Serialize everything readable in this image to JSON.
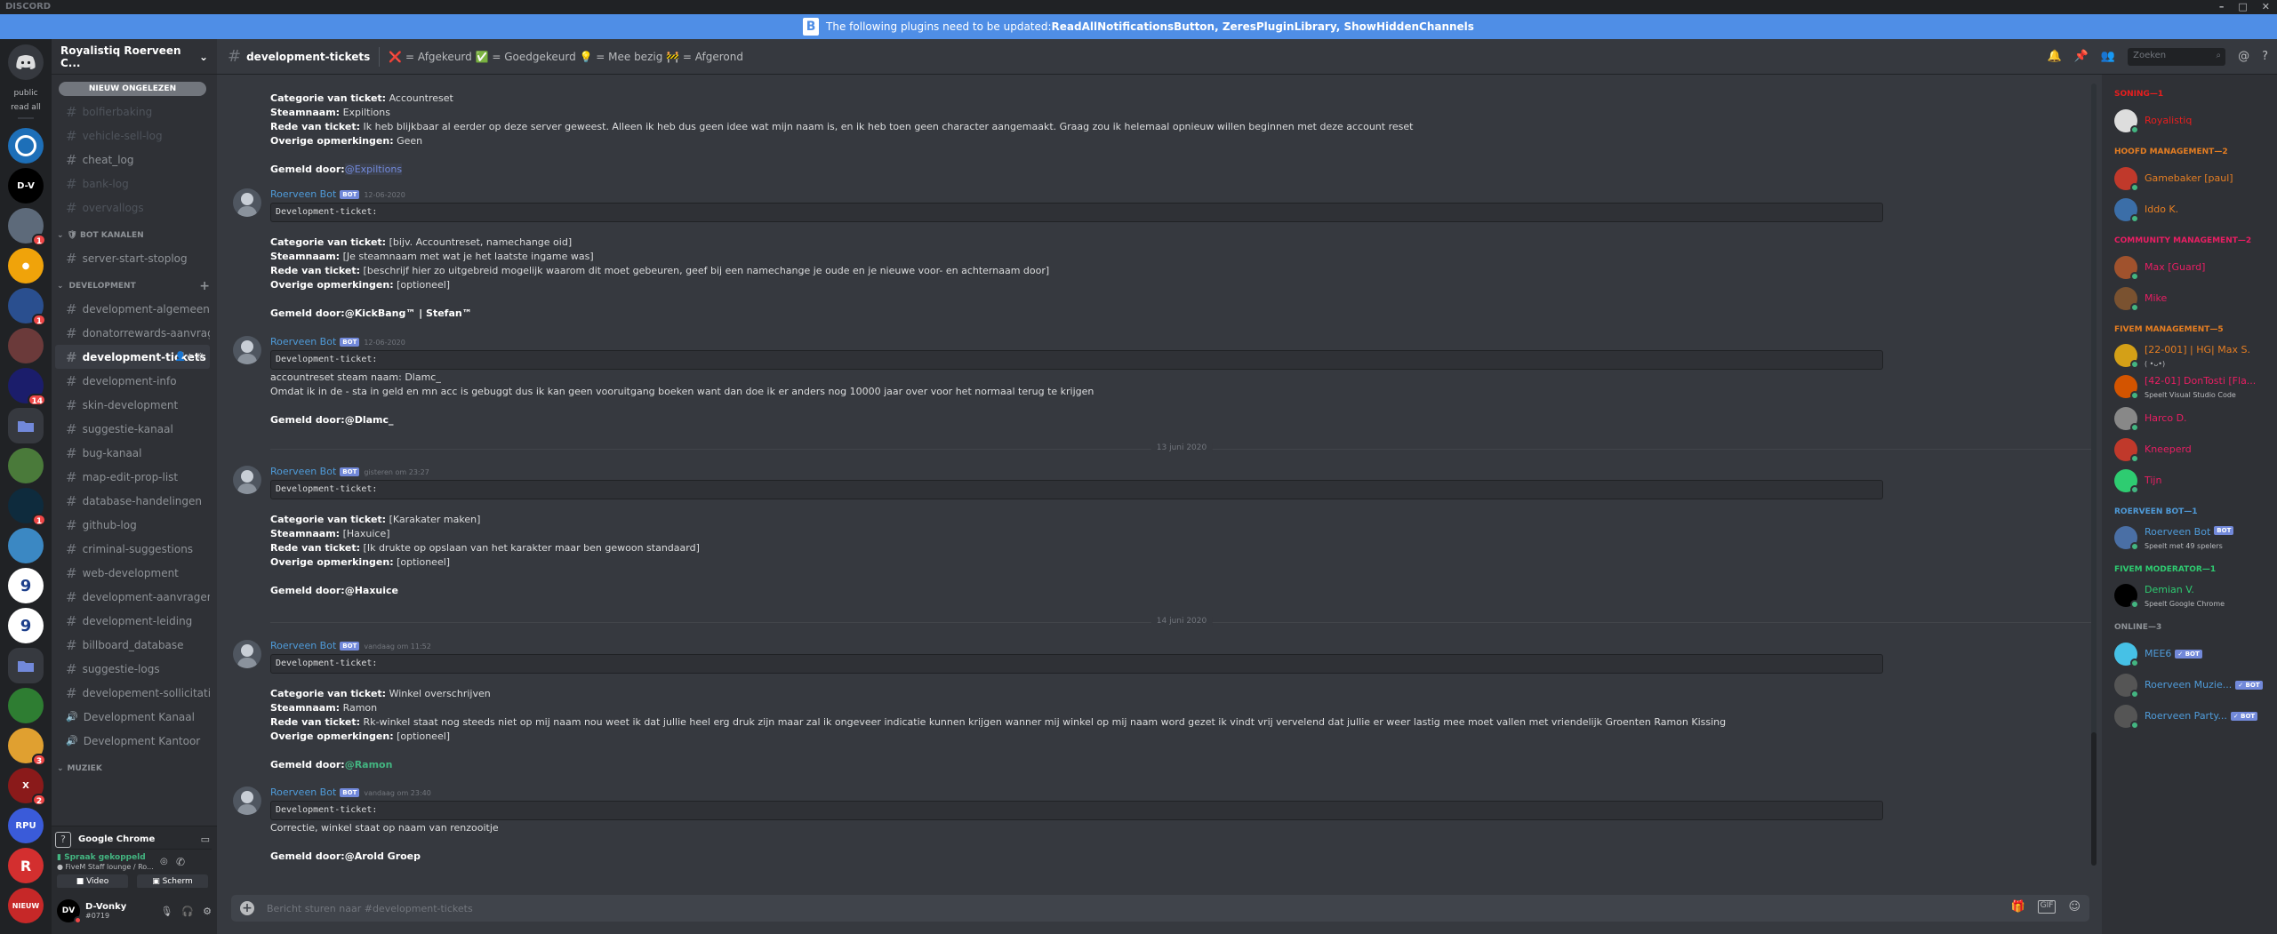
{
  "window": {
    "title": "DISCORD"
  },
  "banner": {
    "text_prefix": "The following plugins need to be updated: ",
    "plugins": "ReadAllNotificationsButton, ZeresPluginLibrary, ShowHiddenChannels"
  },
  "rail": {
    "labels": {
      "public": "public",
      "read_all": "read all",
      "new": "NIEUW",
      "rpu": "RPU"
    },
    "badges": [
      "1",
      "1",
      "14",
      "1",
      "3",
      "2"
    ]
  },
  "guild": {
    "name": "Royalistiq Roerveen C...",
    "unread_button": "NIEUW ONGELEZEN"
  },
  "channels_top": [
    {
      "name": "bolfierbaking",
      "muted": true
    },
    {
      "name": "vehicle-sell-log",
      "muted": true
    },
    {
      "name": "cheat_log",
      "muted": false
    },
    {
      "name": "bank-log",
      "muted": true
    },
    {
      "name": "overvallogs",
      "muted": true
    }
  ],
  "cat_bot": "BOT KANALEN",
  "channels_bot": [
    {
      "name": "server-start-stoplog"
    }
  ],
  "cat_dev": "DEVELOPMENT",
  "channels_dev": [
    {
      "name": "development-algemeen"
    },
    {
      "name": "donatorrewards-aanvrag..."
    },
    {
      "name": "development-tickets",
      "active": true
    },
    {
      "name": "development-info"
    },
    {
      "name": "skin-development"
    },
    {
      "name": "suggestie-kanaal"
    },
    {
      "name": "bug-kanaal"
    },
    {
      "name": "map-edit-prop-list"
    },
    {
      "name": "database-handelingen"
    },
    {
      "name": "github-log"
    },
    {
      "name": "criminal-suggestions"
    },
    {
      "name": "web-development"
    },
    {
      "name": "development-aanvragen"
    },
    {
      "name": "development-leiding"
    },
    {
      "name": "billboard_database"
    },
    {
      "name": "suggestie-logs"
    },
    {
      "name": "developement-sollicitaties"
    }
  ],
  "voice_channels": [
    "Development Kanaal",
    "Development Kantoor"
  ],
  "cat_music": "MUZIEK",
  "activity": {
    "name": "Google Chrome"
  },
  "voice": {
    "status": "Spraak gekoppeld",
    "channel": "FiveM Staff lounge / Ro...",
    "video": "Video",
    "screen": "Scherm"
  },
  "user": {
    "name": "D-Vonky",
    "tag": "#0719"
  },
  "header": {
    "channel": "development-tickets",
    "topic": "❌ = Afgekeurd ✅ = Goedgekeurd 💡 = Mee bezig 🚧 = Afgerond",
    "search_placeholder": "Zoeken"
  },
  "messages": {
    "m0": {
      "l1_label": "Categorie van ticket:",
      "l1_val": " Accountreset",
      "l2_label": "Steamnaam:",
      "l2_val": " Expiltions",
      "l3_label": "Rede van ticket:",
      "l3_val": " Ik heb blijkbaar al eerder op deze server geweest. Alleen ik heb dus geen idee wat mijn naam is, en ik heb toen geen character aangemaakt. Graag zou ik helemaal opnieuw willen beginnen met deze account reset",
      "l4_label": "Overige opmerkingen:",
      "l4_val": " Geen",
      "reporter_label": "Gemeld door:",
      "reporter": "@Expiltions"
    },
    "m1": {
      "author": "Roerveen Bot",
      "badge": "BOT",
      "time": "12-06-2020",
      "code": "Development-ticket:",
      "l1_label": "Categorie van ticket:",
      "l1_val": " [bijv. Accountreset, namechange oid]",
      "l2_label": "Steamnaam:",
      "l2_val": " [Je steamnaam met wat je het laatste ingame was]",
      "l3_label": "Rede van ticket:",
      "l3_val": " [beschrijf hier zo uitgebreid mogelijk waarom dit moet gebeuren, geef bij een namechange je oude en je nieuwe voor- en achternaam door]",
      "l4_label": "Overige opmerkingen:",
      "l4_val": " [optioneel]",
      "reporter_label": "Gemeld door:",
      "reporter": "@KickBang™ | Stefan™"
    },
    "m2": {
      "author": "Roerveen Bot",
      "badge": "BOT",
      "time": "12-06-2020",
      "code": "Development-ticket:",
      "t1": "accountreset steam naam: Dlamc_",
      "t2": "Omdat ik in de - sta in geld en mn acc is gebuggt  dus ik kan geen vooruitgang boeken want dan doe ik er anders nog 10000 jaar over voor het normaal terug te krijgen",
      "reporter_label": "Gemeld door:",
      "reporter": "@Dlamc_"
    },
    "d1": "13 juni 2020",
    "m3": {
      "author": "Roerveen Bot",
      "badge": "BOT",
      "time": "gisteren om 23:27",
      "code": "Development-ticket:",
      "l1_label": "Categorie van ticket:",
      "l1_val": " [Karakater maken]",
      "l2_label": "Steamnaam:",
      "l2_val": " [Haxuice]",
      "l3_label": "Rede van ticket:",
      "l3_val": " [Ik drukte op opslaan van het karakter maar ben gewoon standaard]",
      "l4_label": "Overige opmerkingen:",
      "l4_val": " [optioneel]",
      "reporter_label": "Gemeld door:",
      "reporter": "@Haxuice"
    },
    "d2": "14 juni 2020",
    "m4": {
      "author": "Roerveen Bot",
      "badge": "BOT",
      "time": "vandaag om 11:52",
      "code": "Development-ticket:",
      "l1_label": "Categorie van ticket:",
      "l1_val": " Winkel overschrijven",
      "l2_label": "Steamnaam:",
      "l2_val": " Ramon",
      "l3_label": "Rede van ticket:",
      "l3_val": " Rk-winkel staat nog steeds niet op mij naam nou weet ik dat jullie heel erg druk zijn maar zal ik ongeveer indicatie kunnen krijgen wanner mij winkel op mij naam word gezet ik vindt vrij vervelend dat jullie er weer lastig mee moet vallen met vriendelijk Groenten Ramon Kissing",
      "l4_label": "Overige opmerkingen:",
      "l4_val": " [optioneel]",
      "reporter_label": "Gemeld door:",
      "reporter": "@Ramon"
    },
    "m5": {
      "author": "Roerveen Bot",
      "badge": "BOT",
      "time": "vandaag om 23:40",
      "code": "Development-ticket:",
      "t1": "Correctie, winkel staat op naam van renzooitje",
      "reporter_label": "Gemeld door:",
      "reporter": "@Arold Groep"
    }
  },
  "composer": {
    "placeholder": "Bericht sturen naar #development-tickets"
  },
  "members": {
    "c1": "SONING—1",
    "c1_m": [
      {
        "name": "Royalistiq",
        "color": "#e91e1e"
      }
    ],
    "c2": "HOOFD MANAGEMENT—2",
    "c2_m": [
      {
        "name": "Gamebaker [paul]",
        "color": "#e67e22"
      },
      {
        "name": "Iddo K.",
        "color": "#e67e22"
      }
    ],
    "c3": "COMMUNITY MANAGEMENT—2",
    "c3_m": [
      {
        "name": "Max [Guard]",
        "color": "#e91e63"
      },
      {
        "name": "Mike",
        "color": "#e91e63"
      }
    ],
    "c4": "FIVEM MANAGEMENT—5",
    "c4_m": [
      {
        "name": "[22-001] | HG| Max S.",
        "color": "#e67e22",
        "sub": "( •ᴗ•)"
      },
      {
        "name": "[42-01] DonTosti [Fla...",
        "color": "#e91e63",
        "sub": "Speelt Visual Studio Code"
      },
      {
        "name": "Harco D.",
        "color": "#e91e63"
      },
      {
        "name": "Kneeperd",
        "color": "#e91e63"
      },
      {
        "name": "Tijn",
        "color": "#e91e63"
      }
    ],
    "c5": "ROERVEEN BOT—1",
    "c5_m": [
      {
        "name": "Roerveen Bot",
        "color": "#4f9bd9",
        "sub": "Speelt met 49 spelers",
        "bot": "BOT"
      }
    ],
    "c6": "FIVEM MODERATOR—1",
    "c6_m": [
      {
        "name": "Demian V.",
        "color": "#2ecc71",
        "sub": "Speelt Google Chrome"
      }
    ],
    "c7": "ONLINE—3",
    "c7_m": [
      {
        "name": "MEE6",
        "color": "#4f9bd9",
        "bot": "✓ BOT"
      },
      {
        "name": "Roerveen Muzie...",
        "color": "#4f9bd9",
        "bot": "✓ BOT"
      },
      {
        "name": "Roerveen Party...",
        "color": "#4f9bd9",
        "bot": "✓ BOT"
      }
    ]
  },
  "colors": {
    "accent": "#7289da",
    "banner": "#4f8ee6",
    "online": "#43b581",
    "mention_bg": "#f04747"
  }
}
